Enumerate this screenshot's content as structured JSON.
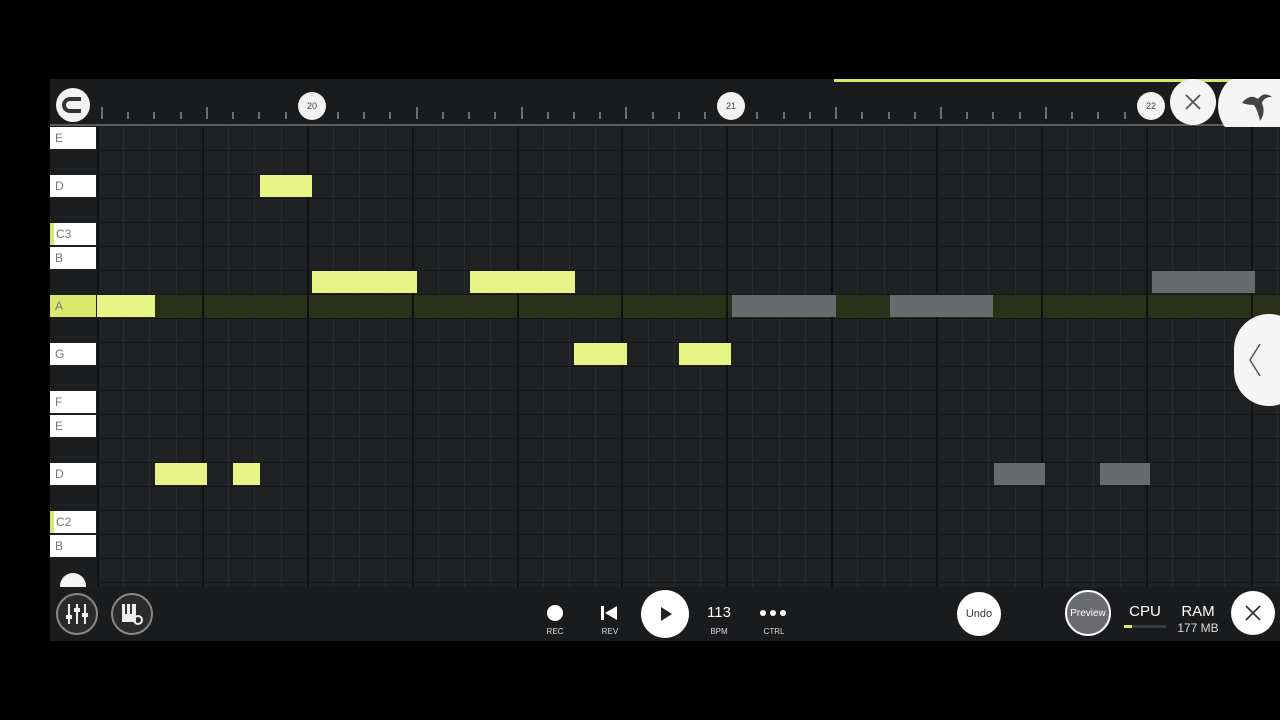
{
  "ruler": {
    "markers": [
      "20",
      "21",
      "22"
    ]
  },
  "piano_keys": [
    {
      "label": "E",
      "kind": "white"
    },
    {
      "label": "D",
      "kind": "white"
    },
    {
      "label": "C3",
      "kind": "c"
    },
    {
      "label": "B",
      "kind": "white"
    },
    {
      "label": "A",
      "kind": "active"
    },
    {
      "label": "G",
      "kind": "white"
    },
    {
      "label": "F",
      "kind": "white"
    },
    {
      "label": "E",
      "kind": "white"
    },
    {
      "label": "D",
      "kind": "white"
    },
    {
      "label": "C2",
      "kind": "c"
    },
    {
      "label": "B",
      "kind": "white"
    }
  ],
  "notes_color": "#e7f587",
  "ghost_color": "#686a6d",
  "accent_color": "#d8e86a",
  "transport": {
    "rec_label": "REC",
    "rev_label": "REV",
    "bpm_value": "113",
    "bpm_label": "BPM",
    "ctrl_label": "CTRL",
    "undo_label": "Undo",
    "preview_label": "Preview",
    "cpu_label": "CPU",
    "ram_label": "RAM",
    "ram_value": "177 MB"
  },
  "icons": [
    "magnet-icon",
    "close-icon",
    "fl-fruit-logo-icon",
    "chevron-left-icon",
    "mixer-icon",
    "piano-settings-icon",
    "record-icon",
    "rewind-icon",
    "play-icon",
    "dots-icon",
    "close-icon"
  ]
}
